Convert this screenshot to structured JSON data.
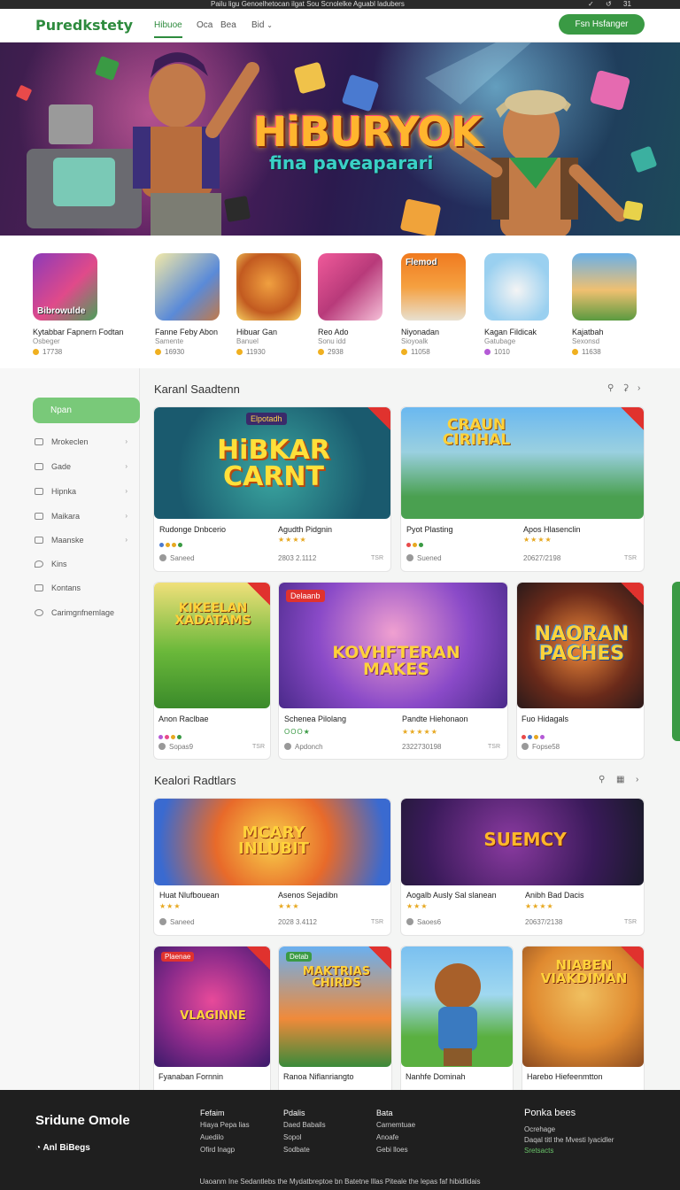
{
  "topstrip": {
    "message": "Pailu ligu Genoelhetocan ilgat Sou Scnolelke Aguabl ladubers",
    "icons": [
      "✓",
      "↺",
      "31"
    ]
  },
  "header": {
    "logo": "Puredkstety",
    "nav": [
      "Hibuoe",
      "Oca",
      "Bea",
      "Bid"
    ],
    "cta": "Fsn Hsfanger"
  },
  "hero": {
    "title": "HiBURYOK",
    "subtitle": "fina paveaparari"
  },
  "apps": [
    {
      "thumb_label": "Bibrowulde",
      "title": "Kytabbar Fapnern Fodtan",
      "sub": "Osbeger",
      "rating": "17738",
      "dot": "#f0b020"
    },
    {
      "thumb_label": "",
      "title": "Fanne Feby Abon",
      "sub": "Samente",
      "rating": "16930",
      "dot": "#f0b020"
    },
    {
      "thumb_label": "",
      "title": "Hibuar Gan",
      "sub": "Banuel",
      "rating": "11930",
      "dot": "#f0b020"
    },
    {
      "thumb_label": "",
      "title": "Reo Ado",
      "sub": "Sonu idd",
      "rating": "2938",
      "dot": "#f0b020"
    },
    {
      "thumb_label": "Flemod",
      "title": "Niyonadan",
      "sub": "Sioyoalk",
      "rating": "11058",
      "dot": "#f0b020"
    },
    {
      "thumb_label": "",
      "title": "Kagan Fildicak",
      "sub": "Gatubage",
      "rating": "1010",
      "dot": "#b45ad6"
    },
    {
      "thumb_label": "",
      "title": "Kajatbah",
      "sub": "Sexonsd",
      "rating": "11638",
      "dot": "#f0b020"
    }
  ],
  "sidebar": {
    "button": "Npan",
    "items": [
      "Mrokeclen",
      "Gade",
      "Hipnka",
      "Maikara",
      "Maanske",
      "Kins",
      "Kontans",
      "Carimgnfnemlage"
    ]
  },
  "section1": {
    "title": "Karanl Saadtenn",
    "icons": [
      "⚲",
      "⚳",
      "›"
    ],
    "cards": [
      {
        "art": "HiBKAR CARNT",
        "tag": "Elpotadh",
        "name_left": "Rudonge Dnbcerio",
        "name_right": "Agudth Pidgnin",
        "stars_right": "★★★★",
        "meta_left": "Saneed",
        "meta_right": "2803 2.1112",
        "badge": "TSR"
      },
      {
        "art": "CRAUN CIRIHAL",
        "tag": "",
        "name_left": "Pyot Plasting",
        "name_right": "Apos Hlasenclin",
        "stars_right": "★★★★",
        "meta_left": "Suened",
        "meta_right": "20627/2198",
        "badge": "TSR"
      },
      {
        "art": "KIKEELAN XADATAMS",
        "tag": "",
        "name_left": "Anon Raclbae",
        "name_right": "",
        "stars_right": "",
        "meta_left": "Sopas9",
        "meta_right": "",
        "badge": "TSR"
      },
      {
        "art": "KOVHFTERAN MAKES",
        "tag": "Delaanb",
        "name_left": "Schenea Pilolang",
        "name_right": "Pandte Hiehonaon",
        "stars_right": "★★★★★",
        "meta_left": "Apdonch",
        "meta_right": "2322730198",
        "badge": "TSR"
      },
      {
        "art": "NAORAN PACHES",
        "tag": "",
        "name_left": "Fuo Hidagals",
        "name_right": "",
        "stars_right": "",
        "meta_left": "Fopse58",
        "meta_right": "",
        "badge": ""
      }
    ]
  },
  "section2": {
    "title": "Kealori Radtlars",
    "icons": [
      "⚲",
      "▦",
      "›"
    ],
    "cards": [
      {
        "art": "MCARY INLUBIT",
        "tag": "",
        "name_left": "Huat Nlufbouean",
        "name_right": "Asenos Sejadibn",
        "stars_left": "★★★",
        "stars_right": "★★★",
        "meta_left": "Saneed",
        "meta_right": "2028 3.4112",
        "badge": "TSR"
      },
      {
        "art": "SUEMCY",
        "tag": "",
        "name_left": "Aogalb Ausly Sal slanean",
        "name_right": "Anibh Bad Dacis",
        "stars_left": "★★★",
        "stars_right": "★★★★",
        "meta_left": "Saoes6",
        "meta_right": "20637/2138",
        "badge": "TSR"
      },
      {
        "art": "VLAGINNE",
        "tag": "Plaenae",
        "name_left": "Fyanaban Fornnin",
        "name_right": ""
      },
      {
        "art": "MAKTRIAS CHIRDS",
        "tag": "Detab",
        "name_left": "Ranoa Niflanriangto",
        "name_right": ""
      },
      {
        "art": "",
        "tag": "",
        "name_left": "Nanhfe Dominah",
        "name_right": ""
      },
      {
        "art": "NIABEN VIAKDIMAN",
        "tag": "",
        "name_left": "Harebo Hiefeenmtton",
        "name_right": ""
      }
    ]
  },
  "footer": {
    "brand": "Sridune Omole",
    "brand2": "Anl BiBegs",
    "cols": [
      {
        "head": "Fefaim",
        "items": [
          "Hiaya Pepa lias",
          "Auedilo",
          "Ofird lnagp"
        ]
      },
      {
        "head": "Pdalis",
        "items": [
          "Daed Babails",
          "Sopol",
          "Sodbate"
        ]
      },
      {
        "head": "Bata",
        "items": [
          "Carnemtuae",
          "Anoafe",
          "Gebi lloes"
        ]
      },
      {
        "head": "Ponka bees",
        "items": [
          "Ocrehage",
          "Daqal titl the Mvesti lyacidler",
          "Sretsacts"
        ]
      }
    ],
    "copyright": "Uaoanm Ine Sedantlebs the Mydatbreptoe bn Batetne lllas Piteale the lepas faf hibidlidais"
  },
  "colors": {
    "accent": "#3a9a44",
    "brand": "#2e8b3e",
    "sidebar_button": "#79c979",
    "footer": "#1f1f1f"
  }
}
